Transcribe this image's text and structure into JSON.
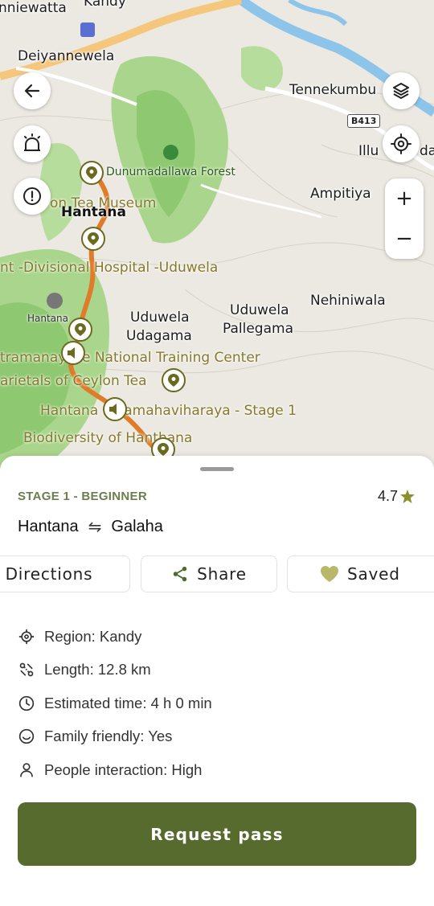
{
  "map": {
    "labels": {
      "niewatta": "nniewatta",
      "kandy": "Kandy",
      "deiyannewela": "Deiyannewela",
      "tennekumbu": "Tennekumbu",
      "illu": "Illu",
      "dar": "dar",
      "ampitiya": "Ampitiya",
      "forest": "Dunumadallawa Forest",
      "museum": "on Tea Museum",
      "hantana_town": "Hantana",
      "hospital": "nt -Divisional Hospital -Uduwela",
      "hantana_peak": "Hantana",
      "uduwela_udagama_1": "Uduwela",
      "uduwela_udagama_2": "Udagama",
      "uduwela_pallegama_1": "Uduwela",
      "uduwela_pallegama_2": "Pallegama",
      "nehiniwala": "Nehiniwala",
      "training_center": "tramanayake National Training Center",
      "ceylon_tea": "arietals of Ceylon Tea",
      "stage1": "Hantana Rajamahaviharaya - Stage 1",
      "biodiversity": "Biodiversity of Hanthana"
    },
    "road_badge": "B413",
    "zoom_in": "+",
    "zoom_out": "−"
  },
  "trail": {
    "stage": "STAGE 1 - BEGINNER",
    "rating": "4.7",
    "from": "Hantana",
    "to": "Galaha",
    "direction_icon": "⇋"
  },
  "actions": {
    "directions": "Directions",
    "share": "Share",
    "saved": "Saved"
  },
  "details": [
    {
      "icon": "region-icon",
      "text": "Region: Kandy"
    },
    {
      "icon": "length-icon",
      "text": "Length: 12.8 km"
    },
    {
      "icon": "clock-icon",
      "text": "Estimated time: 4 h 0 min"
    },
    {
      "icon": "smile-icon",
      "text": "Family friendly: Yes"
    },
    {
      "icon": "person-icon",
      "text": "People interaction: High"
    }
  ],
  "cta": "Request pass",
  "colors": {
    "accent": "#566b2d",
    "stage_text": "#6e7d4f",
    "route": "#e07b2a",
    "star": "#8d8f2a",
    "heart": "#b9b86a"
  }
}
